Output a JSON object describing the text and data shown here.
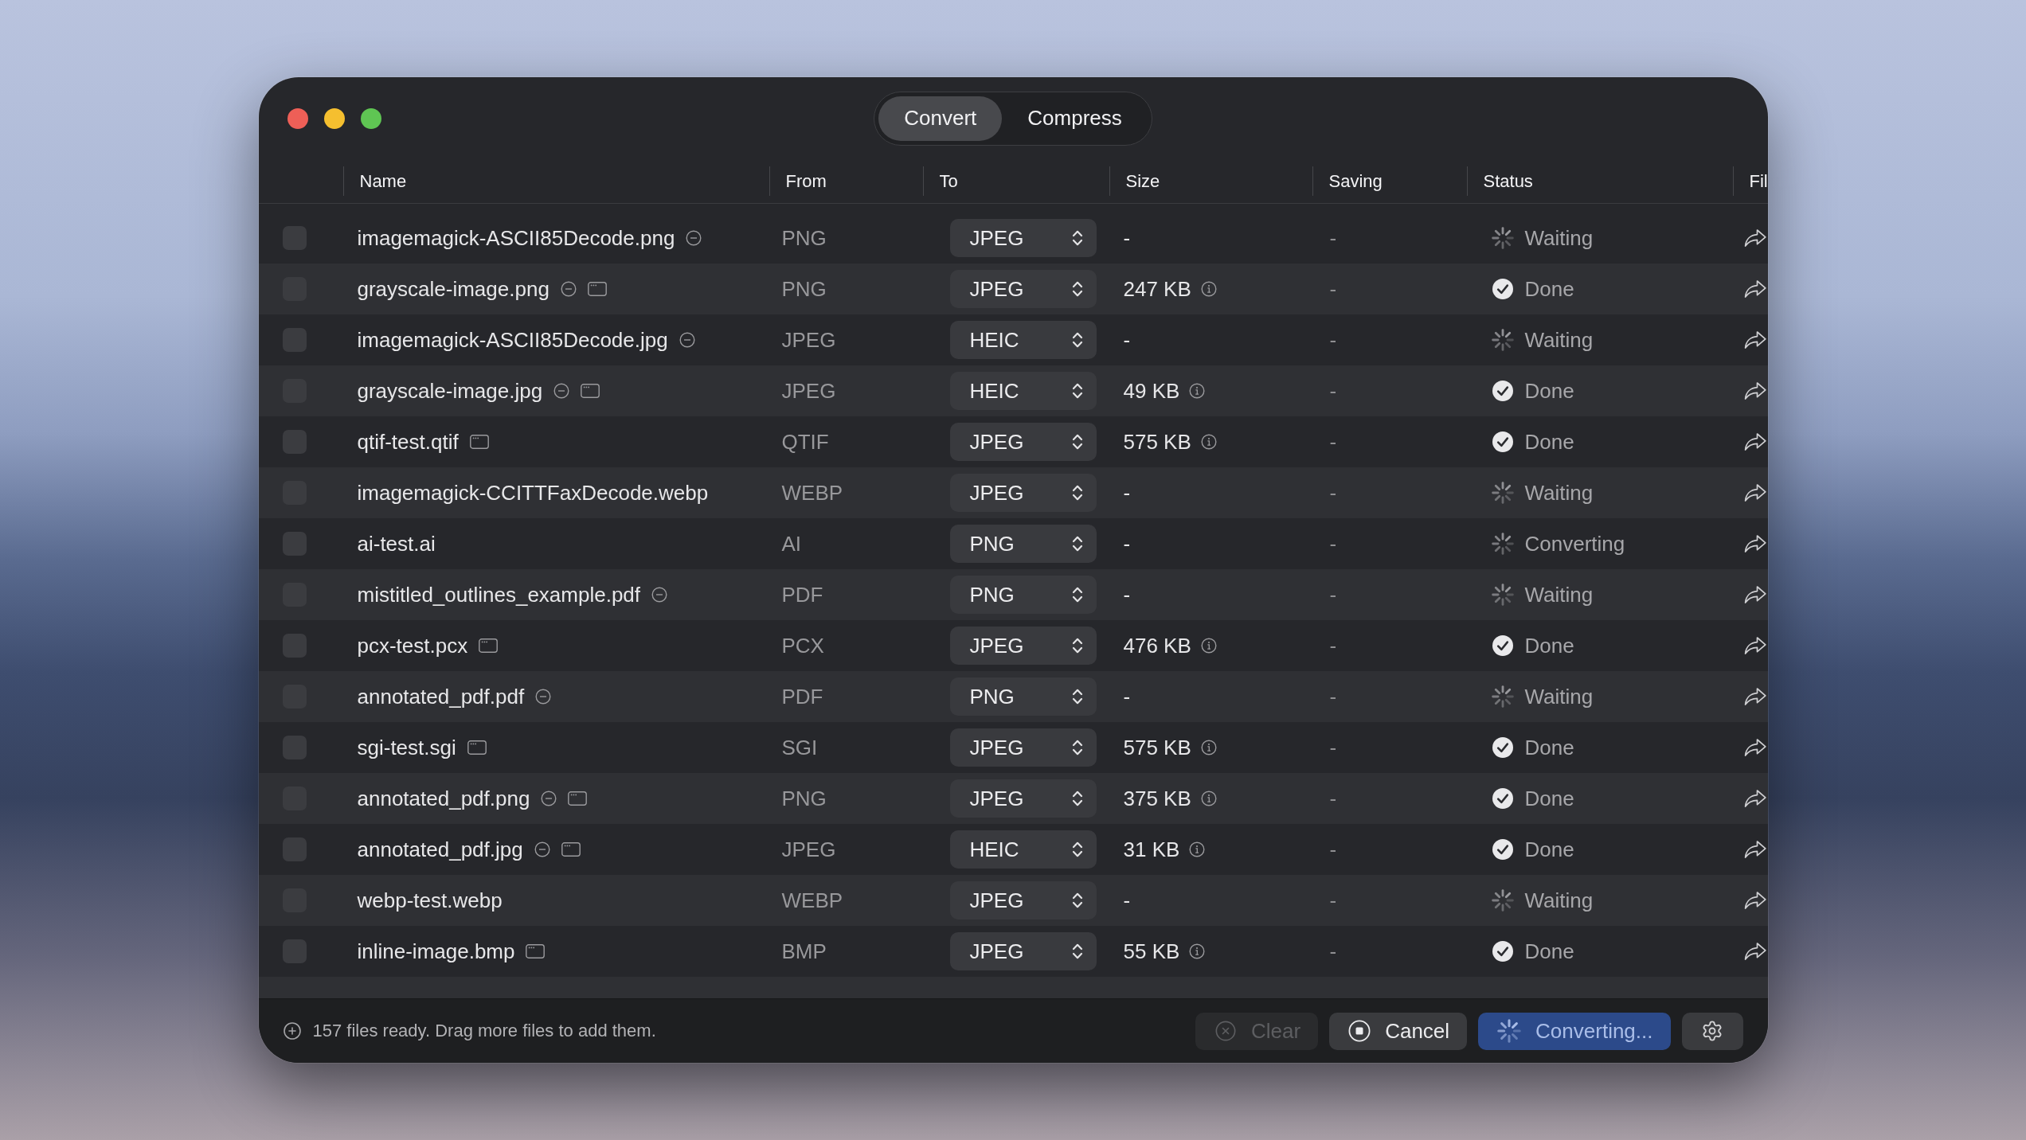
{
  "mode_tabs": [
    {
      "label": "Convert",
      "selected": true
    },
    {
      "label": "Compress",
      "selected": false
    }
  ],
  "table": {
    "columns": [
      "Name",
      "From",
      "To",
      "Size",
      "Saving",
      "Status",
      "Fil"
    ],
    "rows": [
      {
        "checked": false,
        "name": "imagemagick-ASCII85Decode.png",
        "flags": [
          {
            "kind": "minus"
          }
        ],
        "from": "PNG",
        "to": "JPEG",
        "size": "-",
        "size_info": false,
        "saving": "-",
        "status": "Waiting",
        "done": false
      },
      {
        "checked": false,
        "name": "grayscale-image.png",
        "flags": [
          {
            "kind": "minus"
          },
          {
            "kind": "window"
          }
        ],
        "from": "PNG",
        "to": "JPEG",
        "size": "247 KB",
        "size_info": true,
        "saving": "-",
        "status": "Done",
        "done": true
      },
      {
        "checked": false,
        "name": "imagemagick-ASCII85Decode.jpg",
        "flags": [
          {
            "kind": "minus"
          }
        ],
        "from": "JPEG",
        "to": "HEIC",
        "size": "-",
        "size_info": false,
        "saving": "-",
        "status": "Waiting",
        "done": false
      },
      {
        "checked": false,
        "name": "grayscale-image.jpg",
        "flags": [
          {
            "kind": "minus"
          },
          {
            "kind": "window"
          }
        ],
        "from": "JPEG",
        "to": "HEIC",
        "size": "49 KB",
        "size_info": true,
        "saving": "-",
        "status": "Done",
        "done": true
      },
      {
        "checked": false,
        "name": "qtif-test.qtif",
        "flags": [
          {
            "kind": "window"
          }
        ],
        "from": "QTIF",
        "to": "JPEG",
        "size": "575 KB",
        "size_info": true,
        "saving": "-",
        "status": "Done",
        "done": true
      },
      {
        "checked": false,
        "name": "imagemagick-CCITTFaxDecode.webp",
        "from": "WEBP",
        "to": "JPEG",
        "size": "-",
        "size_info": false,
        "saving": "-",
        "status": "Waiting",
        "done": false
      },
      {
        "checked": false,
        "name": "ai-test.ai",
        "from": "AI",
        "to": "PNG",
        "size": "-",
        "size_info": false,
        "saving": "-",
        "status": "Converting",
        "done": false
      },
      {
        "checked": false,
        "name": "mistitled_outlines_example.pdf",
        "flags": [
          {
            "kind": "minus"
          }
        ],
        "from": "PDF",
        "to": "PNG",
        "size": "-",
        "size_info": false,
        "saving": "-",
        "status": "Waiting",
        "done": false
      },
      {
        "checked": false,
        "name": "pcx-test.pcx",
        "flags": [
          {
            "kind": "window"
          }
        ],
        "from": "PCX",
        "to": "JPEG",
        "size": "476 KB",
        "size_info": true,
        "saving": "-",
        "status": "Done",
        "done": true
      },
      {
        "checked": false,
        "name": "annotated_pdf.pdf",
        "flags": [
          {
            "kind": "minus"
          }
        ],
        "from": "PDF",
        "to": "PNG",
        "size": "-",
        "size_info": false,
        "saving": "-",
        "status": "Waiting",
        "done": false
      },
      {
        "checked": false,
        "name": "sgi-test.sgi",
        "flags": [
          {
            "kind": "window"
          }
        ],
        "from": "SGI",
        "to": "JPEG",
        "size": "575 KB",
        "size_info": true,
        "saving": "-",
        "status": "Done",
        "done": true
      },
      {
        "checked": false,
        "name": "annotated_pdf.png",
        "flags": [
          {
            "kind": "minus"
          },
          {
            "kind": "window"
          }
        ],
        "from": "PNG",
        "to": "JPEG",
        "size": "375 KB",
        "size_info": true,
        "saving": "-",
        "status": "Done",
        "done": true
      },
      {
        "checked": false,
        "name": "annotated_pdf.jpg",
        "flags": [
          {
            "kind": "minus"
          },
          {
            "kind": "window"
          }
        ],
        "from": "JPEG",
        "to": "HEIC",
        "size": "31 KB",
        "size_info": true,
        "saving": "-",
        "status": "Done",
        "done": true
      },
      {
        "checked": false,
        "name": "webp-test.webp",
        "from": "WEBP",
        "to": "JPEG",
        "size": "-",
        "size_info": false,
        "saving": "-",
        "status": "Waiting",
        "done": false
      },
      {
        "checked": false,
        "name": "inline-image.bmp",
        "flags": [
          {
            "kind": "window"
          }
        ],
        "from": "BMP",
        "to": "JPEG",
        "size": "55 KB",
        "size_info": true,
        "saving": "-",
        "status": "Done",
        "done": true
      }
    ]
  },
  "footer": {
    "message": "157 files ready. Drag more files to add them.",
    "buttons": [
      {
        "label": "Clear",
        "kind": "clear",
        "disabled": true
      },
      {
        "label": "Cancel",
        "kind": "cancel",
        "disabled": false
      },
      {
        "label": "Converting...",
        "kind": "progress",
        "disabled": false
      }
    ]
  }
}
